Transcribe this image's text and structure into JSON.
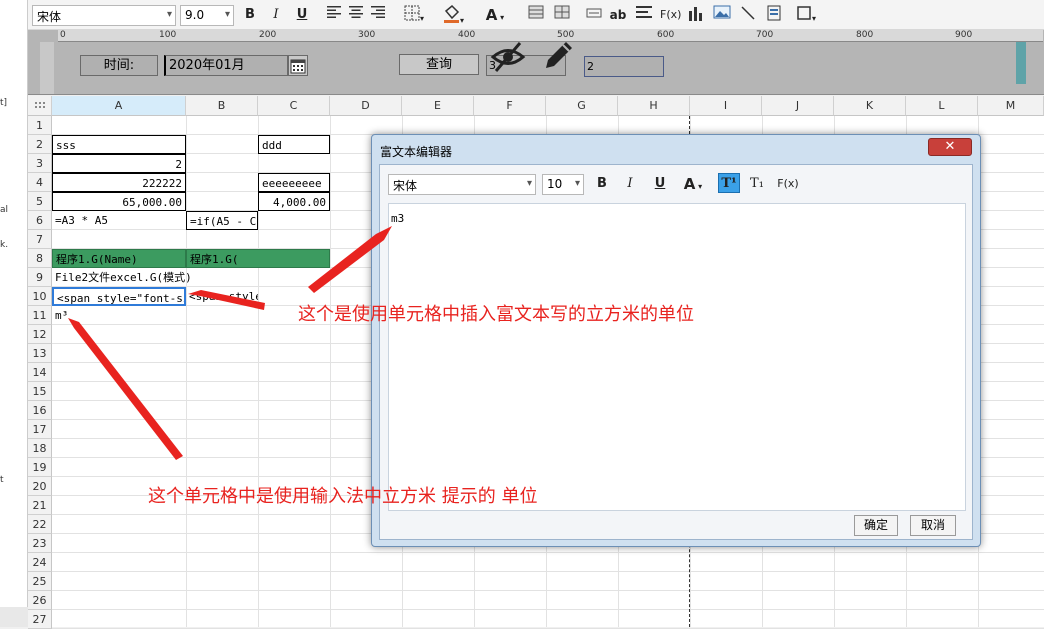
{
  "left_strip": {
    "texts": [
      "t]",
      "al",
      "k.",
      "t"
    ]
  },
  "toolbar": {
    "font_name": "宋体",
    "font_size": "9.0",
    "bold": "B",
    "italic": "I",
    "underline": "U",
    "text_color": "A",
    "wrap_label": "ab",
    "formula_label": "F(x)"
  },
  "designbar": {
    "ruler_ticks": [
      "0",
      "100",
      "200",
      "300",
      "400",
      "500",
      "600",
      "700",
      "800",
      "900"
    ],
    "time_label": "时间:",
    "date_value": "2020年01月",
    "query_button": "查询",
    "field1_value": "3",
    "field2_value": "2"
  },
  "sheet": {
    "columns": [
      "A",
      "B",
      "C",
      "D",
      "E",
      "F",
      "G",
      "H",
      "I",
      "J",
      "K",
      "L",
      "M"
    ],
    "rows": [
      "1",
      "2",
      "3",
      "4",
      "5",
      "6",
      "7",
      "8",
      "9",
      "10",
      "11",
      "12",
      "13",
      "14",
      "15",
      "16",
      "17",
      "18",
      "19",
      "20",
      "21",
      "22",
      "23",
      "24",
      "25",
      "26",
      "27"
    ],
    "cells": {
      "a2": "sss",
      "c2": "ddd",
      "a3": "2",
      "a4": "222222",
      "c4": "eeeeeeeee",
      "a5": "65,000.00",
      "c5": "4,000.00",
      "a6": "=A3 * A5",
      "b6": "=if(A5 - C5",
      "a8": "程序1.G(Name)",
      "b8": "程序1.G(",
      "a9": "File2文件excel.G(模式)",
      "a10": "<span style=\"font-siz",
      "b10": "<span style",
      "a11": "m³"
    }
  },
  "dialog": {
    "title": "富文本编辑器",
    "close": "✕",
    "font_name": "宋体",
    "font_size": "10",
    "bold": "B",
    "italic": "I",
    "underline": "U",
    "color": "A",
    "superscript": "T¹",
    "subscript": "T₁",
    "formula": "F(x)",
    "content": "m3",
    "ok_button": "确定",
    "cancel_button": "取消"
  },
  "annotations": {
    "top": "这个是使用单元格中插入富文本写的立方米的单位",
    "bottom": "这个单元格中是使用输入法中立方米 提示的 单位"
  },
  "colors": {
    "green_fill": "#3c9b60",
    "selection": "#2f7bd9",
    "annotation": "#e8231f",
    "close_button": "#c8403a"
  }
}
